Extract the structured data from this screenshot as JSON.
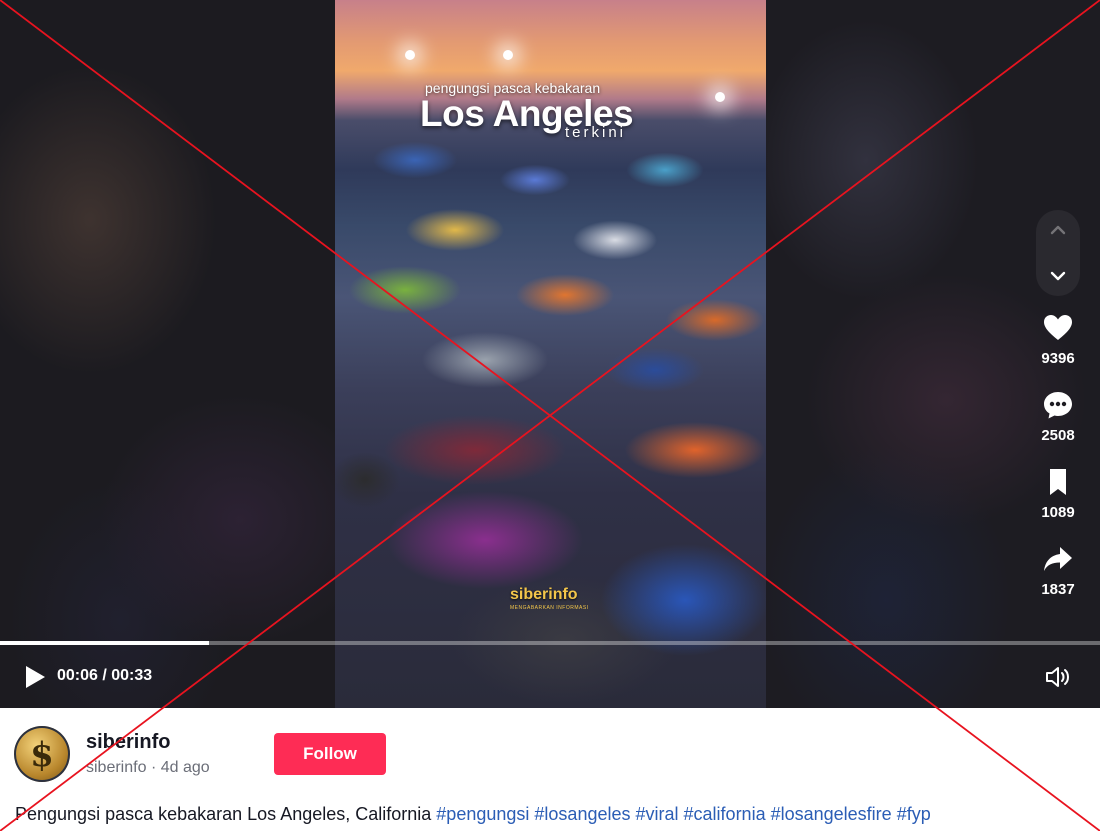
{
  "video": {
    "overlay_subtitle": "pengungsi pasca kebakaran",
    "overlay_title": "Los Angeles",
    "overlay_tag": "terkini",
    "watermark": "siberinfo",
    "watermark_sub": "MENGABARKAN INFORMASI",
    "progress_fraction": 0.19,
    "time_display": "00:06 / 00:33"
  },
  "actions": {
    "likes": "9396",
    "comments": "2508",
    "saves": "1089",
    "shares": "1837"
  },
  "author": {
    "username": "siberinfo",
    "handle": "siberinfo",
    "separator": "·",
    "posted": "4d ago",
    "follow_label": "Follow"
  },
  "caption": {
    "text": "Pengungsi pasca kebakaran Los Angeles, California",
    "hashtags": [
      "#pengungsi",
      "#losangeles",
      "#viral",
      "#california",
      "#losangelesfire",
      "#fyp"
    ]
  },
  "icons": {
    "nav_up": "chevron-up-icon",
    "nav_down": "chevron-down-icon",
    "like": "heart-icon",
    "comment": "comment-icon",
    "save": "bookmark-icon",
    "share": "share-icon",
    "play": "play-icon",
    "volume": "volume-icon"
  },
  "colors": {
    "follow_button": "#fe2c55",
    "hashtag": "#2b5db5",
    "watermark": "#f3c64a",
    "cross_overlay": "#e8131f"
  }
}
